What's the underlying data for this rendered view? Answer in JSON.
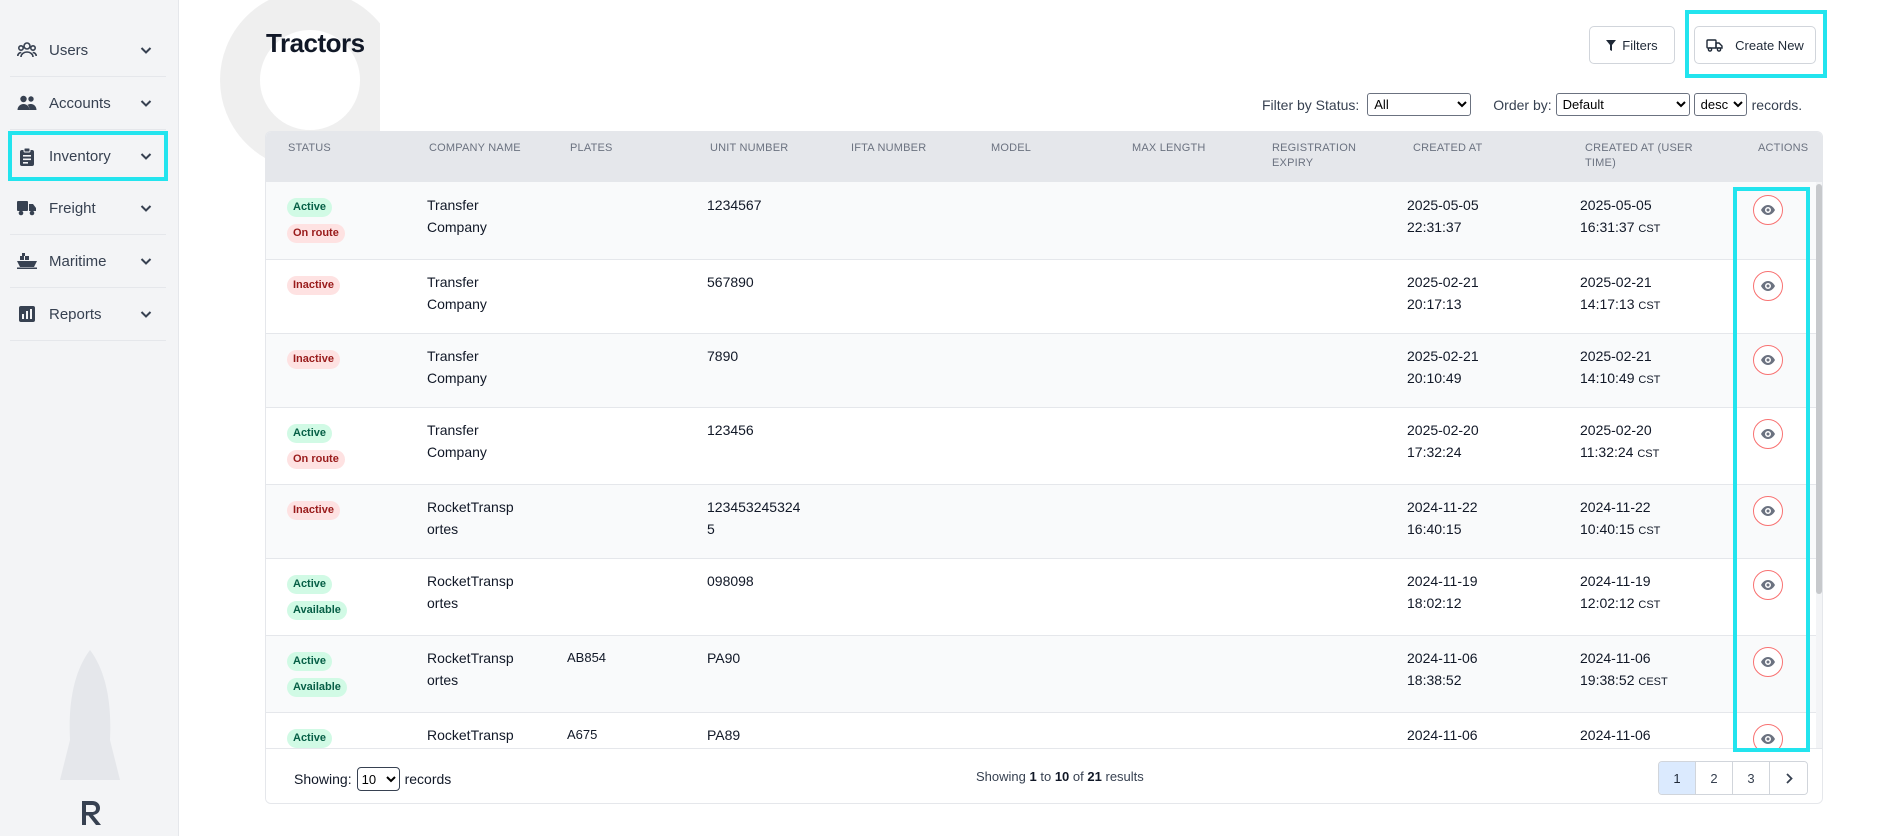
{
  "sidebar": {
    "items": [
      {
        "label": "Users",
        "icon": "users-icon"
      },
      {
        "label": "Accounts",
        "icon": "people-icon"
      },
      {
        "label": "Inventory",
        "icon": "clipboard-icon"
      },
      {
        "label": "Freight",
        "icon": "truck-icon"
      },
      {
        "label": "Maritime",
        "icon": "ship-icon"
      },
      {
        "label": "Reports",
        "icon": "chart-icon"
      }
    ]
  },
  "header": {
    "title": "Tractors",
    "filters_label": "Filters",
    "create_label": "Create New"
  },
  "filters": {
    "status_label": "Filter by Status:",
    "status_value": "All",
    "order_label": "Order by:",
    "order_value": "Default",
    "direction_value": "desc",
    "records_suffix": "records."
  },
  "table": {
    "columns": [
      "STATUS",
      "COMPANY NAME",
      "PLATES",
      "UNIT NUMBER",
      "IFTA NUMBER",
      "MODEL",
      "MAX LENGTH",
      "REGISTRATION EXPIRY",
      "CREATED AT",
      "CREATED AT (USER TIME)",
      "ACTIONS"
    ],
    "rows": [
      {
        "badges": [
          {
            "text": "Active",
            "color": "green"
          },
          {
            "text": "On route",
            "color": "red"
          }
        ],
        "company": "Transfer Company",
        "plates": "",
        "unit": "1234567",
        "created_date": "2025-05-05",
        "created_time": "22:31:37",
        "user_date": "2025-05-05",
        "user_time": "16:31:37",
        "tz": "CST"
      },
      {
        "badges": [
          {
            "text": "Inactive",
            "color": "red"
          }
        ],
        "company": "Transfer Company",
        "plates": "",
        "unit": "567890",
        "created_date": "2025-02-21",
        "created_time": "20:17:13",
        "user_date": "2025-02-21",
        "user_time": "14:17:13",
        "tz": "CST"
      },
      {
        "badges": [
          {
            "text": "Inactive",
            "color": "red"
          }
        ],
        "company": "Transfer Company",
        "plates": "",
        "unit": "7890",
        "created_date": "2025-02-21",
        "created_time": "20:10:49",
        "user_date": "2025-02-21",
        "user_time": "14:10:49",
        "tz": "CST"
      },
      {
        "badges": [
          {
            "text": "Active",
            "color": "green"
          },
          {
            "text": "On route",
            "color": "red"
          }
        ],
        "company": "Transfer Company",
        "plates": "",
        "unit": "123456",
        "created_date": "2025-02-20",
        "created_time": "17:32:24",
        "user_date": "2025-02-20",
        "user_time": "11:32:24",
        "tz": "CST"
      },
      {
        "badges": [
          {
            "text": "Inactive",
            "color": "red"
          }
        ],
        "company": "RocketTransportes",
        "plates": "",
        "unit": "1234532453245",
        "created_date": "2024-11-22",
        "created_time": "16:40:15",
        "user_date": "2024-11-22",
        "user_time": "10:40:15",
        "tz": "CST"
      },
      {
        "badges": [
          {
            "text": "Active",
            "color": "green"
          },
          {
            "text": "Available",
            "color": "green"
          }
        ],
        "company": "RocketTransportes",
        "plates": "",
        "unit": "098098",
        "created_date": "2024-11-19",
        "created_time": "18:02:12",
        "user_date": "2024-11-19",
        "user_time": "12:02:12",
        "tz": "CST"
      },
      {
        "badges": [
          {
            "text": "Active",
            "color": "green"
          },
          {
            "text": "Available",
            "color": "green"
          }
        ],
        "company": "RocketTransportes",
        "plates": "AB854",
        "unit": "PA90",
        "created_date": "2024-11-06",
        "created_time": "18:38:52",
        "user_date": "2024-11-06",
        "user_time": "19:38:52",
        "tz": "CEST"
      },
      {
        "badges": [
          {
            "text": "Active",
            "color": "green"
          }
        ],
        "company": "RocketTransportes",
        "plates": "A675",
        "unit": "PA89",
        "created_date": "2024-11-06",
        "created_time": "",
        "user_date": "2024-11-06",
        "user_time": "",
        "tz": ""
      }
    ]
  },
  "footer": {
    "showing_label": "Showing:",
    "page_size": "10",
    "records_label": "records",
    "summary_prefix": "Showing",
    "from": "1",
    "to_word": "to",
    "to": "10",
    "of_word": "of",
    "total": "21",
    "results_word": "results",
    "pages": [
      "1",
      "2",
      "3"
    ],
    "current_page": "1",
    "next_icon": "chevron-right-icon"
  },
  "colors": {
    "highlight": "#22e4ee",
    "badge_green_bg": "#d1fae5",
    "badge_red_bg": "#fee2e2",
    "view_border": "#f87171",
    "active_page": "#dbeafe"
  }
}
